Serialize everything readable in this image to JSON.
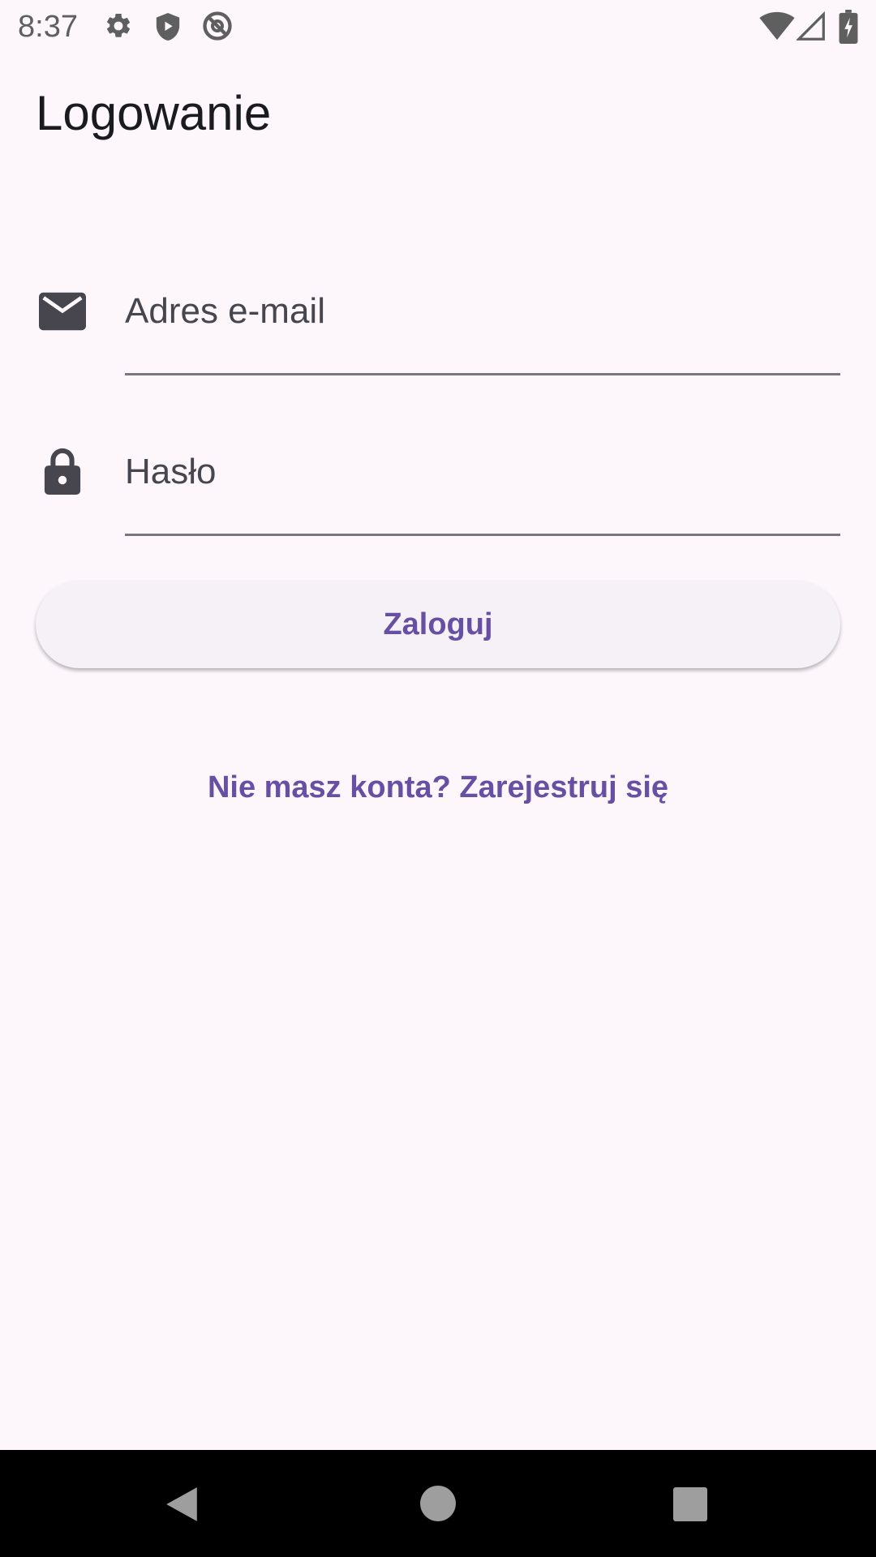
{
  "status_bar": {
    "time": "8:37",
    "icons": [
      "settings-icon",
      "shield-play-icon",
      "do-not-disturb-icon",
      "wifi-icon",
      "signal-icon",
      "battery-charging-icon"
    ]
  },
  "page": {
    "title": "Logowanie"
  },
  "form": {
    "email": {
      "placeholder": "Adres e-mail",
      "value": "",
      "icon": "email-icon"
    },
    "password": {
      "placeholder": "Hasło",
      "value": "",
      "icon": "lock-icon"
    },
    "login_label": "Zaloguj",
    "register_link": "Nie masz konta? Zarejestruj się"
  },
  "nav_bar": {
    "buttons": [
      "back-icon",
      "home-icon",
      "recents-icon"
    ]
  },
  "colors": {
    "background": "#FDF7FC",
    "primary": "#6750A4",
    "on_surface": "#1B1B1F",
    "outline": "#7A7680",
    "button_surface": "#F6F1F7"
  }
}
